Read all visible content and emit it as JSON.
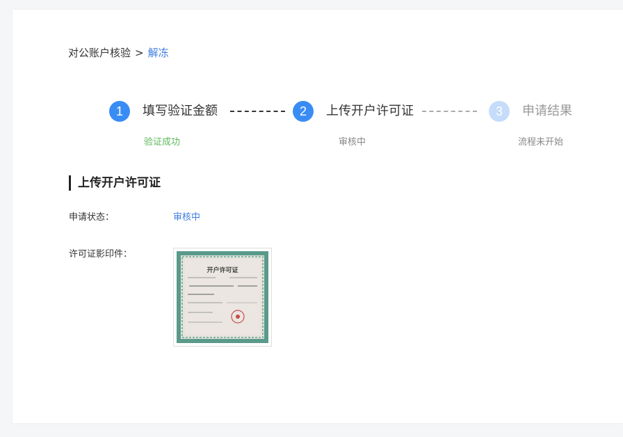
{
  "breadcrumb": {
    "parent": "对公账户核验",
    "separator": ">",
    "current": "解冻"
  },
  "steps": [
    {
      "number": "1",
      "title": "填写验证金额",
      "status": "验证成功",
      "state": "done"
    },
    {
      "number": "2",
      "title": "上传开户许可证",
      "status": "审核中",
      "state": "active"
    },
    {
      "number": "3",
      "title": "申请结果",
      "status": "流程未开始",
      "state": "pending"
    }
  ],
  "section": {
    "title": "上传开户许可证"
  },
  "fields": {
    "status_label": "申请状态：",
    "status_value": "审核中",
    "license_label": "许可证影印件："
  },
  "certificate": {
    "title": "开户许可证"
  },
  "colors": {
    "accent": "#3a8cf5",
    "link": "#3f7ddf",
    "success": "#5cb85c",
    "pending_step": "#c5dcfa"
  }
}
